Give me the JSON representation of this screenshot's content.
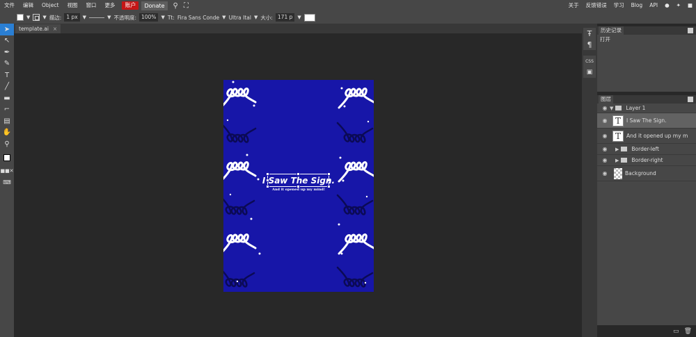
{
  "menubar": {
    "items": [
      "文件",
      "编辑",
      "Object",
      "视图",
      "窗口",
      "更多"
    ],
    "account": "账户",
    "donate": "Donate",
    "right_items": [
      "关于",
      "反馈错误",
      "学习",
      "Blog",
      "API"
    ]
  },
  "options": {
    "stroke_label": "描边:",
    "stroke_value": "1 px",
    "opacity_label": "不透明度:",
    "opacity_value": "100%",
    "font_label": "Tt:",
    "font_value": "Fira Sans Conde",
    "style_value": "Ultra Ital",
    "size_label": "大小:",
    "size_value": "171 p"
  },
  "document": {
    "tab": "template.ai",
    "title": "I Saw The Sign.",
    "subtitle": "And it opened up my mind!",
    "background_color": "#1716a8"
  },
  "panels": {
    "history_title": "历史记录",
    "history_items": [
      "打开"
    ],
    "layers_title": "图层",
    "layers": [
      {
        "name": "Layer 1"
      },
      {
        "name": "I Saw The Sign."
      },
      {
        "name": "And it opened up my m"
      },
      {
        "name": "Border-left"
      },
      {
        "name": "Border-right"
      },
      {
        "name": "Background"
      }
    ]
  },
  "colors": {
    "accent": "#2a7fd4",
    "account_button": "#c41616"
  }
}
